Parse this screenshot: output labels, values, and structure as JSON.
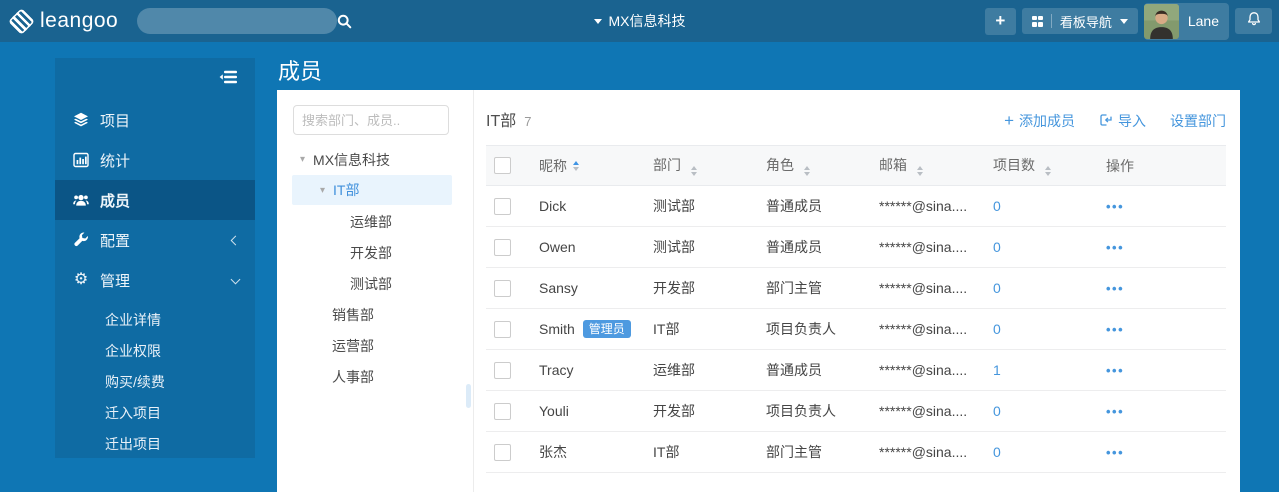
{
  "icons": {
    "plus": "+",
    "caret_down": "▾",
    "gear": "⚙",
    "ellipsis": "•••"
  },
  "topbar": {
    "logo": "leangoo",
    "org": "MX信息科技",
    "board_nav": "看板导航",
    "user": "Lane"
  },
  "sidebar": {
    "items": [
      "项目",
      "统计",
      "成员",
      "配置",
      "管理"
    ],
    "submenu": [
      "企业详情",
      "企业权限",
      "购买/续费",
      "迁入项目",
      "迁出项目"
    ]
  },
  "page": {
    "title": "成员"
  },
  "tree": {
    "search_placeholder": "搜索部门、成员..",
    "root": "MX信息科技",
    "selected": "IT部",
    "children": [
      "运维部",
      "开发部",
      "测试部"
    ],
    "departments": [
      "销售部",
      "运营部",
      "人事部"
    ]
  },
  "table": {
    "group": "IT部",
    "count": "7",
    "actions": {
      "add": "添加成员",
      "import": "导入",
      "settings": "设置部门"
    },
    "columns": [
      "昵称",
      "部门",
      "角色",
      "邮箱",
      "项目数",
      "操作"
    ],
    "rows": [
      {
        "name": "Dick",
        "badge": "",
        "dept": "测试部",
        "role": "普通成员",
        "email": "******@sina....",
        "projects": "0"
      },
      {
        "name": "Owen",
        "badge": "",
        "dept": "测试部",
        "role": "普通成员",
        "email": "******@sina....",
        "projects": "0"
      },
      {
        "name": "Sansy",
        "badge": "",
        "dept": "开发部",
        "role": "部门主管",
        "email": "******@sina....",
        "projects": "0"
      },
      {
        "name": "Smith",
        "badge": "管理员",
        "dept": "IT部",
        "role": "项目负责人",
        "email": "******@sina....",
        "projects": "0"
      },
      {
        "name": "Tracy",
        "badge": "",
        "dept": "运维部",
        "role": "普通成员",
        "email": "******@sina....",
        "projects": "1"
      },
      {
        "name": "Youli",
        "badge": "",
        "dept": "开发部",
        "role": "项目负责人",
        "email": "******@sina....",
        "projects": "0"
      },
      {
        "name": "张杰",
        "badge": "",
        "dept": "IT部",
        "role": "部门主管",
        "email": "******@sina....",
        "projects": "0"
      }
    ]
  },
  "colors": {
    "topbar": "#1a6390",
    "background": "#0f76b4",
    "sidebar": "#0f6ba3",
    "sidebar_selected": "#0b5586",
    "accent": "#4596dd",
    "tree_selected_bg": "#e9f4fd",
    "badge": "#4e9ae0"
  }
}
